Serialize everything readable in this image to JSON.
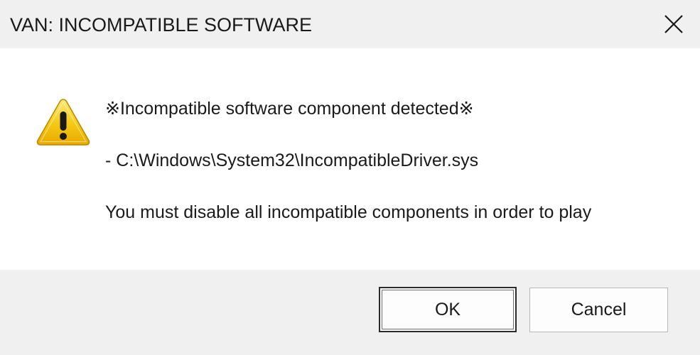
{
  "window": {
    "title": "VAN: INCOMPATIBLE SOFTWARE",
    "close_icon": "close-icon"
  },
  "content": {
    "icon": "warning-icon",
    "heading": "※Incompatible software component detected※",
    "path": " - C:\\Windows\\System32\\IncompatibleDriver.sys",
    "instruction": "You must disable all incompatible components in order to play"
  },
  "buttons": {
    "ok_label": "OK",
    "cancel_label": "Cancel"
  },
  "colors": {
    "titlebar_bg": "#f0f0f0",
    "content_bg": "#ffffff",
    "footer_bg": "#f0f0f0",
    "warning_yellow": "#f3c410",
    "default_button_border": "#2b2b2b"
  }
}
